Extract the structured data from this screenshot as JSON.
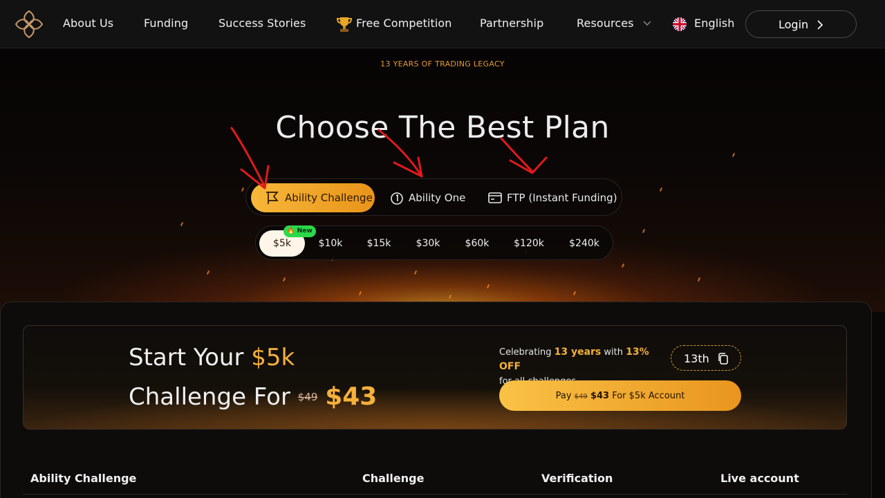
{
  "nav": {
    "items": [
      "About Us",
      "Funding",
      "Success Stories",
      "Free Competition",
      "Partnership",
      "Resources"
    ],
    "language": "English",
    "login": "Login"
  },
  "hero": {
    "legacy": "13 YEARS OF TRADING LEGACY",
    "title": "Choose The Best Plan",
    "plans": [
      "Ability Challenge",
      "Ability One",
      "FTP (Instant Funding)"
    ],
    "active_plan": "Ability Challenge",
    "sizes": [
      "$5k",
      "$10k",
      "$15k",
      "$30k",
      "$60k",
      "$120k",
      "$240k"
    ],
    "active_size": "$5k",
    "new_badge": "🔥 New"
  },
  "promo": {
    "line1_prefix": "Start Your ",
    "line1_amount": "$5k",
    "line2_prefix": "Challenge For ",
    "old_price": "$49",
    "new_price": "$43",
    "celebrate_a": "Celebrating ",
    "celebrate_years": "13 years",
    "celebrate_b": " with ",
    "celebrate_off": "13% OFF",
    "celebrate_c": "for all challenges",
    "code": "13th",
    "pay_a": "Pay ",
    "pay_old": "$49",
    "pay_new": "$43",
    "pay_b": " For $5k Account"
  },
  "table": {
    "headers": [
      "Ability Challenge",
      "Challenge",
      "Verification",
      "Live account"
    ]
  },
  "colors": {
    "accent": "#f5b13a",
    "badge": "#2bd94a",
    "annotation": "#e21a1a"
  }
}
